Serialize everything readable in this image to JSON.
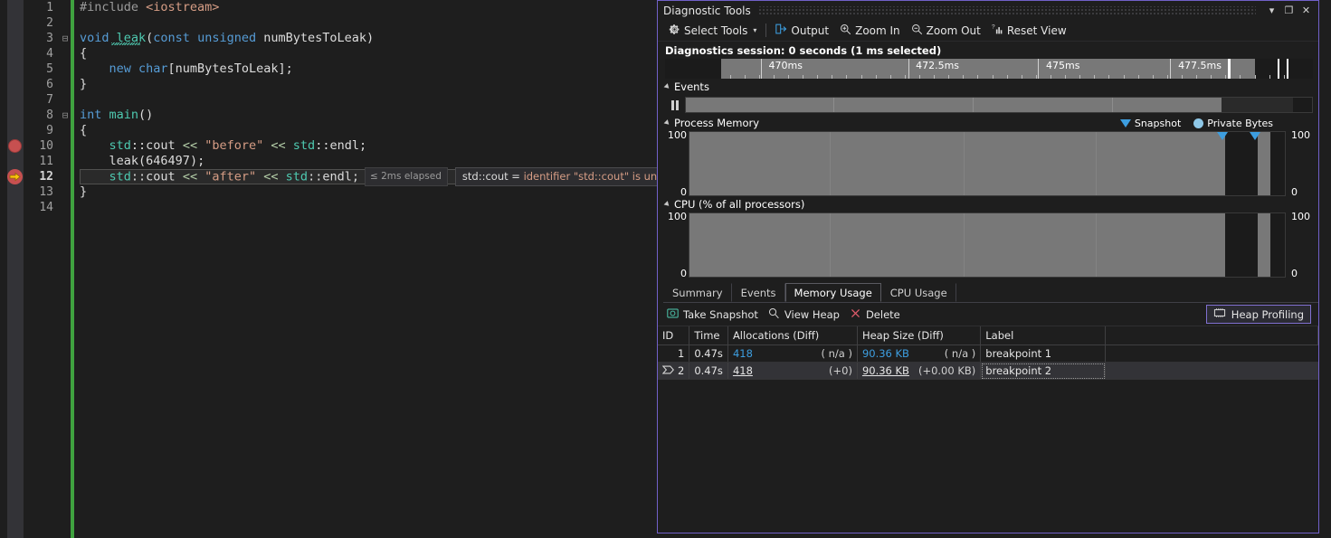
{
  "editor": {
    "lines": [
      {
        "n": "1",
        "fold": "",
        "tokens": [
          {
            "t": "#include ",
            "c": "pp"
          },
          {
            "t": "<iostream>",
            "c": "inc"
          }
        ]
      },
      {
        "n": "2",
        "fold": "",
        "tokens": []
      },
      {
        "n": "3",
        "fold": "-",
        "tokens": [
          {
            "t": "void ",
            "c": "kw"
          },
          {
            "t": "leak",
            "c": "fn"
          },
          {
            "t": "(",
            "c": "punct"
          },
          {
            "t": "const ",
            "c": "kw"
          },
          {
            "t": "unsigned ",
            "c": "kw"
          },
          {
            "t": "numBytesToLeak",
            "c": "id"
          },
          {
            "t": ")",
            "c": "punct"
          }
        ]
      },
      {
        "n": "4",
        "fold": "",
        "tokens": [
          {
            "t": "{",
            "c": "punct"
          }
        ]
      },
      {
        "n": "5",
        "fold": "",
        "tokens": [
          {
            "t": "    ",
            "c": "id"
          },
          {
            "t": "new ",
            "c": "kw"
          },
          {
            "t": "char",
            "c": "kw"
          },
          {
            "t": "[numBytesToLeak];",
            "c": "id"
          }
        ]
      },
      {
        "n": "6",
        "fold": "",
        "tokens": [
          {
            "t": "}",
            "c": "punct"
          }
        ]
      },
      {
        "n": "7",
        "fold": "",
        "tokens": []
      },
      {
        "n": "8",
        "fold": "-",
        "tokens": [
          {
            "t": "int ",
            "c": "kw"
          },
          {
            "t": "main",
            "c": "fn"
          },
          {
            "t": "()",
            "c": "punct"
          }
        ]
      },
      {
        "n": "9",
        "fold": "",
        "tokens": [
          {
            "t": "{",
            "c": "punct"
          }
        ]
      },
      {
        "n": "10",
        "fold": "",
        "tokens": [
          {
            "t": "    ",
            "c": "id"
          },
          {
            "t": "std",
            "c": "typ"
          },
          {
            "t": "::cout ",
            "c": "id"
          },
          {
            "t": "<<",
            "c": "op"
          },
          {
            "t": " ",
            "c": "id"
          },
          {
            "t": "\"before\"",
            "c": "str"
          },
          {
            "t": " ",
            "c": "id"
          },
          {
            "t": "<<",
            "c": "op"
          },
          {
            "t": " ",
            "c": "id"
          },
          {
            "t": "std",
            "c": "typ"
          },
          {
            "t": "::endl;",
            "c": "id"
          }
        ]
      },
      {
        "n": "11",
        "fold": "",
        "tokens": [
          {
            "t": "    ",
            "c": "id"
          },
          {
            "t": "leak(",
            "c": "id"
          },
          {
            "t": "646497",
            "c": "id"
          },
          {
            "t": ");",
            "c": "id"
          }
        ]
      },
      {
        "n": "12",
        "fold": "",
        "tokens": [
          {
            "t": "    ",
            "c": "id"
          },
          {
            "t": "std",
            "c": "typ"
          },
          {
            "t": "::cout ",
            "c": "id"
          },
          {
            "t": "<<",
            "c": "op"
          },
          {
            "t": " ",
            "c": "id"
          },
          {
            "t": "\"after\"",
            "c": "str"
          },
          {
            "t": " ",
            "c": "id"
          },
          {
            "t": "<<",
            "c": "op"
          },
          {
            "t": " ",
            "c": "id"
          },
          {
            "t": "std",
            "c": "typ"
          },
          {
            "t": "::endl;",
            "c": "id"
          }
        ]
      },
      {
        "n": "13",
        "fold": "",
        "tokens": [
          {
            "t": "}",
            "c": "punct"
          }
        ]
      },
      {
        "n": "14",
        "fold": "",
        "tokens": []
      }
    ],
    "current_line_index": 11,
    "breakpoint_line_index": 9,
    "elapsed_tip": "≤ 2ms elapsed",
    "datatip_expression": "std::cout = ",
    "datatip_value": "identifier \"std::cout\" is undefined"
  },
  "diag": {
    "title": "Diagnostic Tools",
    "window_buttons": {
      "dropdown": "▾",
      "maximize": "❐",
      "close": "✕"
    },
    "toolbar": {
      "select_tools": "Select Tools",
      "select_tools_caret": "▾",
      "output": "Output",
      "zoom_in": "Zoom In",
      "zoom_out": "Zoom Out",
      "reset_view": "Reset View"
    },
    "session_text": "Diagnostics session: 0 seconds (1 ms selected)",
    "ruler": {
      "ticks": [
        {
          "label": "470ms",
          "x_pct": 16.0
        },
        {
          "label": "472.5ms",
          "x_pct": 38.7
        },
        {
          "label": "475ms",
          "x_pct": 58.8
        },
        {
          "label": "477.5ms",
          "x_pct": 79.2
        }
      ]
    },
    "events": {
      "header": "Events"
    },
    "process_memory": {
      "header": "Process Memory",
      "legend": [
        {
          "name": "snapshot-marker",
          "label": "Snapshot"
        },
        {
          "name": "private-bytes-marker",
          "label": "Private Bytes"
        }
      ],
      "axis_max": "100",
      "axis_min": "0"
    },
    "cpu": {
      "header": "CPU (% of all processors)",
      "axis_max": "100",
      "axis_min": "0"
    },
    "tabs": [
      {
        "label": "Summary",
        "active": false
      },
      {
        "label": "Events",
        "active": false
      },
      {
        "label": "Memory Usage",
        "active": true
      },
      {
        "label": "CPU Usage",
        "active": false
      }
    ],
    "snapshot_toolbar": {
      "take_snapshot": "Take Snapshot",
      "view_heap": "View Heap",
      "delete": "Delete",
      "heap_profiling": "Heap Profiling"
    },
    "table": {
      "headers": [
        "ID",
        "Time",
        "Allocations (Diff)",
        "Heap Size (Diff)",
        "Label",
        ""
      ],
      "rows": [
        {
          "id": "1",
          "time": "0.47s",
          "alloc": "418",
          "alloc_diff": "( n/a )",
          "heap": "90.36 KB",
          "heap_diff": "( n/a )",
          "label": "breakpoint 1",
          "selected": false
        },
        {
          "id": "2",
          "time": "0.47s",
          "alloc": "418",
          "alloc_diff": "(+0)",
          "heap": "90.36 KB",
          "heap_diff": "(+0.00 KB)",
          "label": "breakpoint 2",
          "selected": true
        }
      ]
    }
  },
  "colors": {
    "accent_blue": "#3d9ee0",
    "panel_border": "#7160c8",
    "breakpoint_red": "#c75050",
    "current_stmt_yellow": "#ffc40d",
    "change_bar_green": "#3fa23f",
    "dim_overlay": "#787878"
  }
}
